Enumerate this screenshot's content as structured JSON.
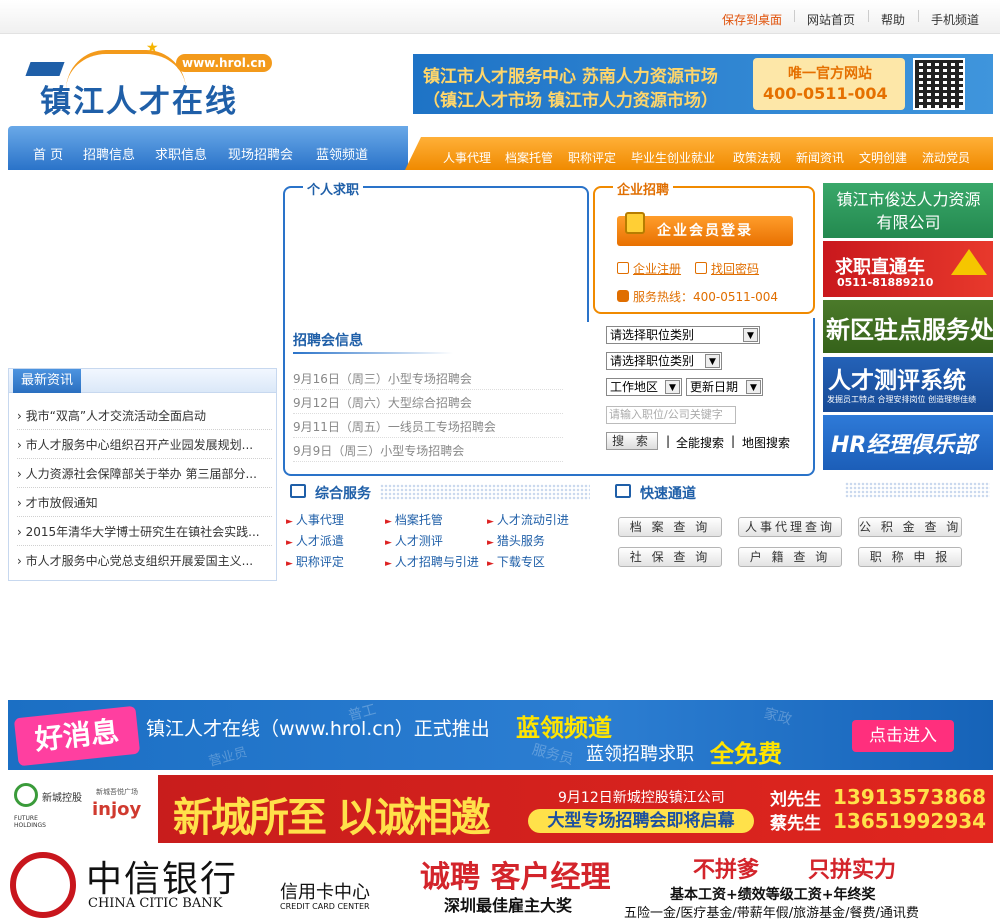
{
  "topbar": {
    "save_desktop": "保存到桌面",
    "home": "网站首页",
    "help": "帮助",
    "mobile": "手机频道"
  },
  "logo": {
    "name": "镇江人才在线",
    "url": "www.hrol.cn"
  },
  "header_banner": {
    "line1": "镇江市人才服务中心 苏南人力资源市场",
    "line2": "（镇江人才市场 镇江市人力资源市场）",
    "official": "唯一官方网站",
    "phone": "400-0511-004"
  },
  "nav_main": [
    "首 页",
    "招聘信息",
    "求职信息",
    "现场招聘会",
    "蓝领频道"
  ],
  "nav_sub": [
    "人事代理",
    "档案托管",
    "职称评定",
    "毕业生创业就业",
    "政策法规",
    "新闻资讯",
    "文明创建",
    "流动党员"
  ],
  "news": {
    "title": "最新资讯",
    "items": [
      "我市“双高”人才交流活动全面启动",
      "市人才服务中心组织召开产业园发展规划...",
      "人力资源社会保障部关于举办 第三届部分...",
      "才市放假通知",
      "2015年清华大学博士研究生在镇社会实践...",
      "市人才服务中心党总支组织开展爱国主义..."
    ]
  },
  "personal": {
    "title": "个人求职"
  },
  "company": {
    "title": "企业招聘",
    "login": "企业会员登录",
    "register": "企业注册",
    "forgot": "找回密码",
    "hotline": "服务热线：400-0511-004"
  },
  "fair": {
    "title": "招聘会信息",
    "items": [
      "9月16日（周三）小型专场招聘会",
      "9月12日（周六）大型综合招聘会",
      "9月11日（周五）一线员工专场招聘会",
      "9月9日（周三）小型专场招聘会"
    ]
  },
  "search": {
    "job_category1": "请选择职位类别",
    "job_category2": "请选择职位类别",
    "area": "工作地区",
    "update_date": "更新日期",
    "keyword_placeholder": "请输入职位/公司关键字",
    "button": "搜 索",
    "fulltext": "全能搜索",
    "map": "地图搜索"
  },
  "services": {
    "title": "综合服务",
    "items": [
      "人事代理",
      "档案托管",
      "人才流动引进",
      "人才派遣",
      "人才测评",
      "猎头服务",
      "职称评定",
      "人才招聘与引进",
      "下载专区"
    ]
  },
  "quick": {
    "title": "快速通道",
    "items": [
      "档 案 查 询",
      "人事代理查询",
      "公 积 金 查 询",
      "社 保 查 询",
      "户 籍 查 询",
      "职 称 申 报"
    ]
  },
  "right_ads": {
    "ad1": "镇江市俊达人力资源有限公司",
    "ad2_title": "求职直通车",
    "ad2_phone": "0511-81889210",
    "ad3": "新区驻点服务处",
    "ad4_title": "人才测评系统",
    "ad4_sub": "发掘员工特点 合理安排岗位 创造理想佳绩",
    "ad5": "HR经理俱乐部"
  },
  "banner1": {
    "tag": "好消息",
    "text": "镇江人才在线（www.hrol.cn）正式推出",
    "channel": "蓝领频道",
    "sub": "蓝领招聘求职",
    "free": "全免费",
    "enter": "点击进入",
    "bg_words": [
      "普工",
      "家政",
      "服务员",
      "营业员"
    ]
  },
  "banner2": {
    "logo_text": "新城控股",
    "logo_en": "FUTURE HOLDINGS",
    "plaza": "新城吾悦广场",
    "injoy": "injoy",
    "slogan": "新城所至 以诚相邀",
    "date_text": "9月12日新城控股镇江公司",
    "event": "大型专场招聘会即将启幕",
    "contact1_name": "刘先生",
    "contact1_phone": "13913573868",
    "contact2_name": "蔡先生",
    "contact2_phone": "13651992934"
  },
  "banner3": {
    "bank_cn": "中信银行",
    "bank_en": "CHINA CITIC BANK",
    "center": "信用卡中心",
    "center_en": "CREDIT CARD CENTER",
    "hire": "诚聘 客户经理",
    "slogan1": "不拼爹",
    "slogan2": "只拼实力",
    "salary": "基本工资+绩效等级工资+年终奖",
    "partial1": "深圳最佳雇主大奖",
    "partial2": "五险一金/医疗基金/带薪年假/旅游基金/餐费/通讯费"
  },
  "colors": {
    "primary_blue": "#2a73c9",
    "accent_orange": "#f08a00"
  }
}
